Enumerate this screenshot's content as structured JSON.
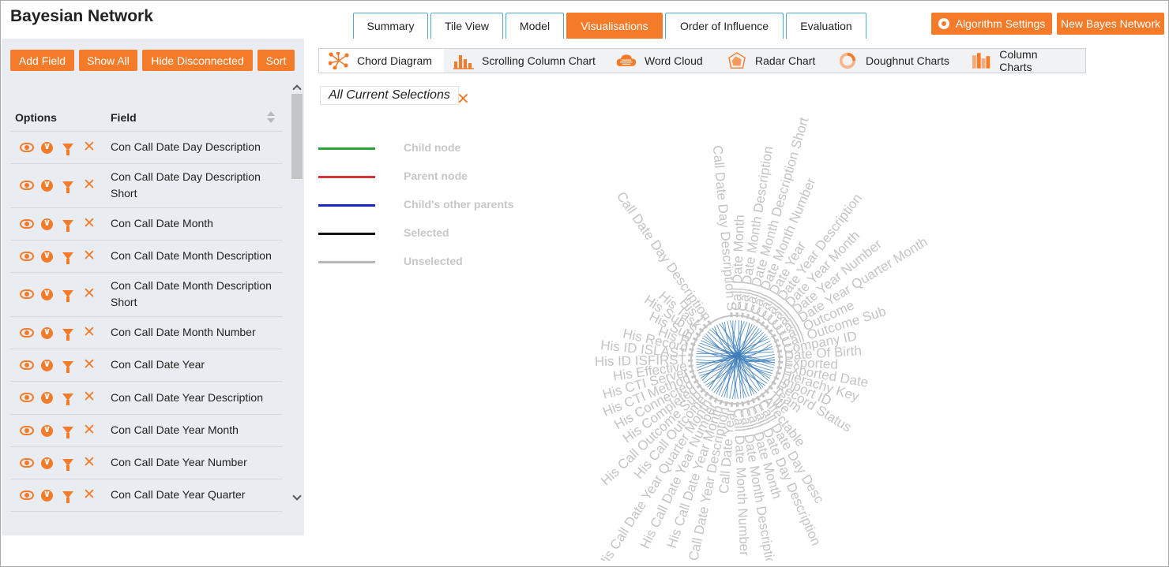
{
  "app": {
    "title": "Bayesian Network"
  },
  "tabs": [
    {
      "label": "Summary",
      "active": false
    },
    {
      "label": "Tile View",
      "active": false
    },
    {
      "label": "Model",
      "active": false
    },
    {
      "label": "Visualisations",
      "active": true
    },
    {
      "label": "Order of Influence",
      "active": false
    },
    {
      "label": "Evaluation",
      "active": false
    }
  ],
  "header_buttons": {
    "algorithm_settings": "Algorithm Settings",
    "new_bayes_network": "New Bayes Network"
  },
  "left_panel": {
    "buttons": {
      "add_field": "Add Field",
      "show_all": "Show All",
      "hide_disconnected": "Hide Disconnected",
      "sort": "Sort"
    },
    "columns": {
      "options": "Options",
      "field": "Field"
    },
    "rows": [
      {
        "field": "Con Call Date Day Description"
      },
      {
        "field": "Con Call Date Day Description Short"
      },
      {
        "field": "Con Call Date Month"
      },
      {
        "field": "Con Call Date Month Description"
      },
      {
        "field": "Con Call Date Month Description Short"
      },
      {
        "field": "Con Call Date Month Number"
      },
      {
        "field": "Con Call Date Year"
      },
      {
        "field": "Con Call Date Year Description"
      },
      {
        "field": "Con Call Date Year Month"
      },
      {
        "field": "Con Call Date Year Number"
      },
      {
        "field": "Con Call Date Year Quarter"
      }
    ]
  },
  "viz_toolbar": [
    {
      "label": "Chord Diagram",
      "icon": "chord-diagram-icon",
      "active": true
    },
    {
      "label": "Scrolling Column Chart",
      "icon": "scrolling-column-chart-icon",
      "active": false
    },
    {
      "label": "Word Cloud",
      "icon": "word-cloud-icon",
      "active": false
    },
    {
      "label": "Radar Chart",
      "icon": "radar-chart-icon",
      "active": false
    },
    {
      "label": "Doughnut Charts",
      "icon": "doughnut-charts-icon",
      "active": false
    },
    {
      "label": "Column Charts",
      "icon": "column-charts-icon",
      "active": false
    }
  ],
  "selections": {
    "label": "All Current Selections"
  },
  "legend": [
    {
      "label": "Child node",
      "color": "#2aa33a"
    },
    {
      "label": "Parent node",
      "color": "#d0343a"
    },
    {
      "label": "Child's other parents",
      "color": "#1626c8"
    },
    {
      "label": "Selected",
      "color": "#111111"
    },
    {
      "label": "Unselected",
      "color": "#b8b8b8"
    }
  ],
  "chord": {
    "node_labels": [
      "Call Date Day Description S",
      "Call Date Month",
      "Call Date Month Description",
      "Call Date Month Description Short",
      "Call Date Month Number",
      "Call Date Year",
      "Call Date Year Description",
      "Call Date Year Month",
      "Call Date Year Number",
      "Call Date Year Quarter Month",
      "Call Outcome",
      "Call Outcome Sub",
      "Company ID",
      "Date Of Birth",
      "Exported",
      "Exported Date",
      "Hierachy Key",
      "Import ID",
      "Record Status",
      "Team",
      "Title",
      "Affectable",
      "Call Date Day Desc",
      "Call Date Day Description",
      "Call Date Month",
      "Call Date Month Description",
      "Call Date Month Number",
      "Call Date Year",
      "His Call Date Year Description",
      "His Call Date Year Month",
      "His Call Date Year Number",
      "His Call Date Year Quarter Month",
      "His Call Outcome",
      "His Call Outcome Sub",
      "His Completed",
      "His Connected",
      "His CTI Method",
      "His CTI Server",
      "His Effective",
      "His ID ISFIRST",
      "His ID ISLAST",
      "His Record",
      "His R",
      "His Sub",
      "His Sub S",
      "His Task",
      "His T",
      "Call Date Day Description"
    ],
    "node_color": "#c4c4c4",
    "chord_color": "#3f7fb8"
  }
}
